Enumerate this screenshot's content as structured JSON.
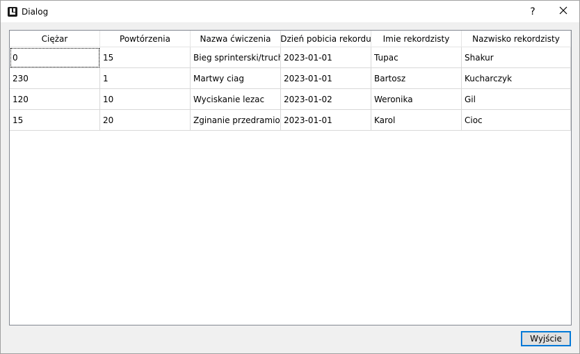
{
  "window": {
    "title": "Dialog",
    "help_label": "?"
  },
  "table": {
    "headers": [
      "Ciężar",
      "Powtórzenia",
      "Nazwa ćwiczenia",
      "Dzień pobicia rekordu",
      "Imie rekordzisty",
      "Nazwisko rekordzisty"
    ],
    "rows": [
      [
        "0",
        "15",
        "Bieg sprinterski/trucht",
        "2023-01-01",
        "Tupac",
        "Shakur"
      ],
      [
        "230",
        "1",
        "Martwy ciag",
        "2023-01-01",
        "Bartosz",
        "Kucharczyk"
      ],
      [
        "120",
        "10",
        "Wyciskanie lezac",
        "2023-01-02",
        "Weronika",
        "Gil"
      ],
      [
        "15",
        "20",
        "Zginanie przedramion",
        "2023-01-01",
        "Karol",
        "Cioc"
      ]
    ]
  },
  "buttons": {
    "exit_label": "Wyjście"
  },
  "icons": {
    "app": "app-icon",
    "close": "close-icon"
  },
  "colors": {
    "focus_border": "#0078d7",
    "grid_line": "#d8d8d8"
  }
}
